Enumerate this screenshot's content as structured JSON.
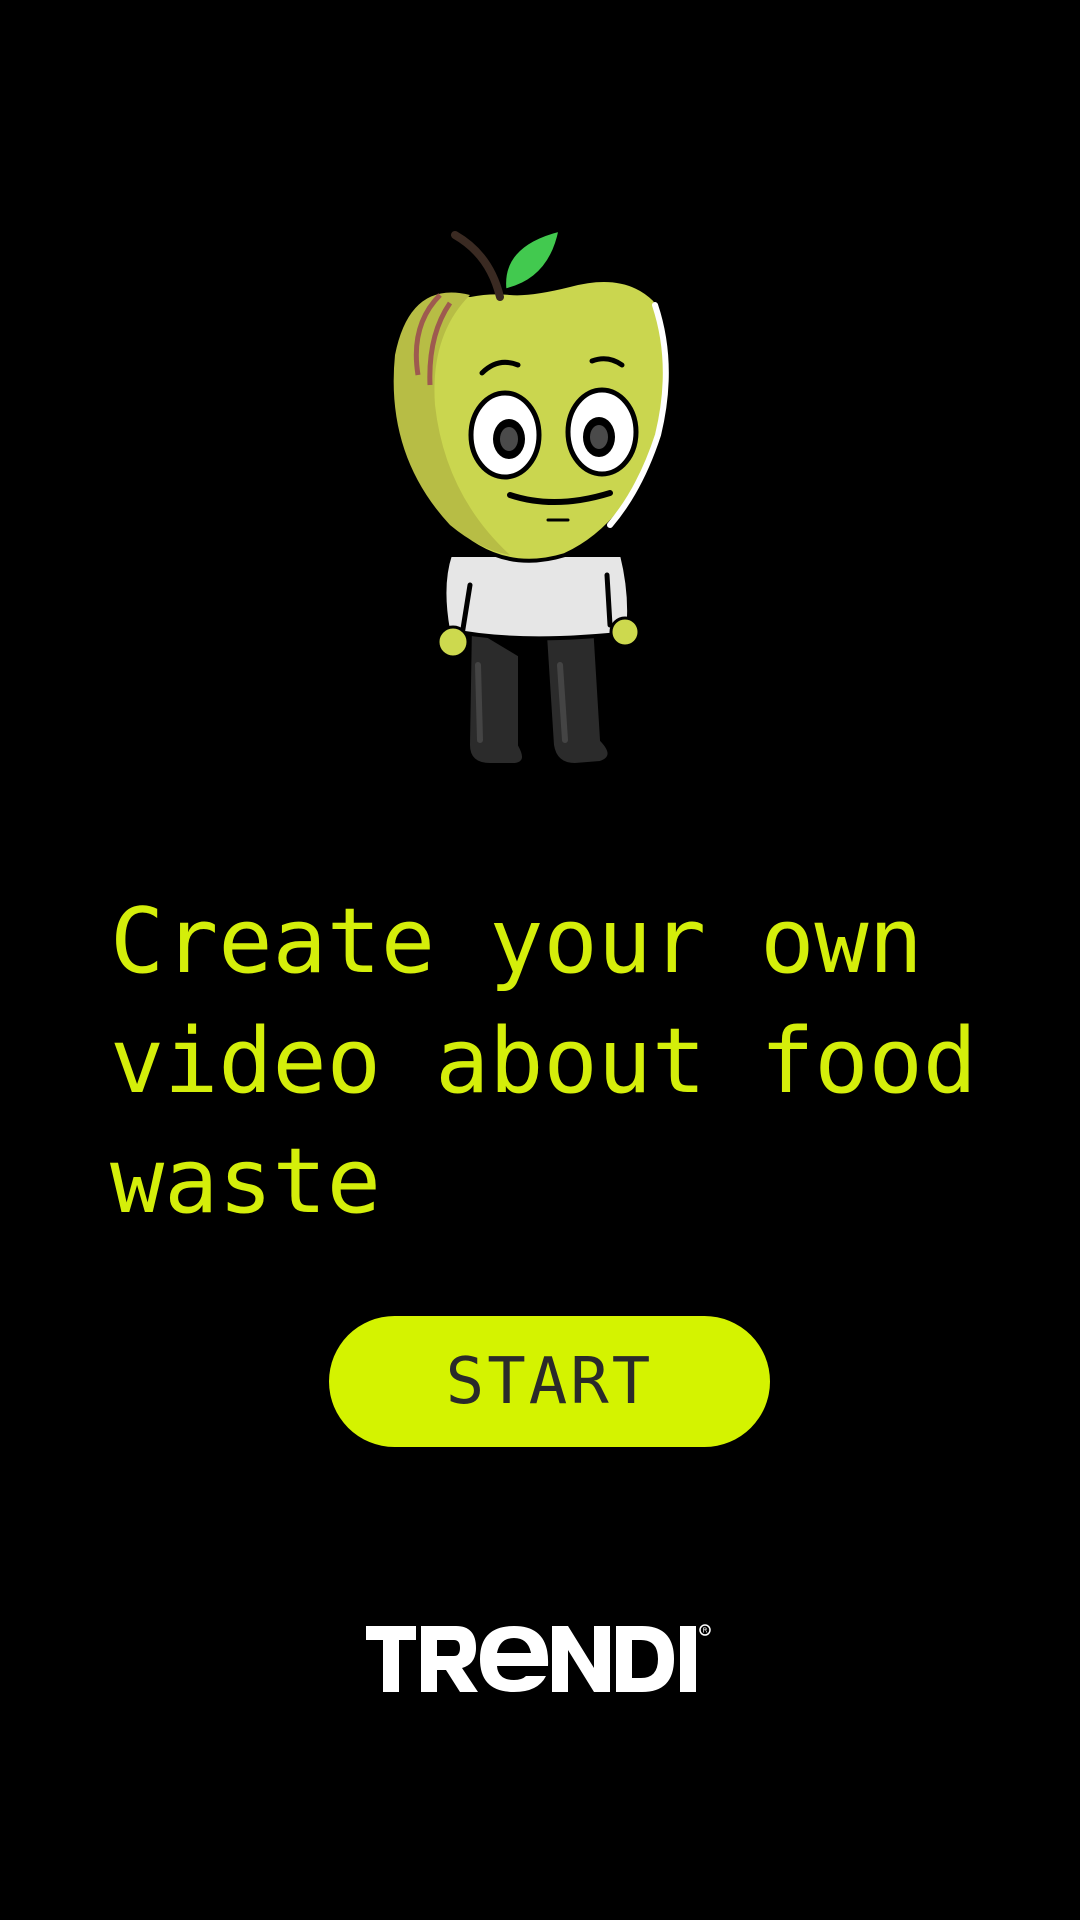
{
  "colors": {
    "background": "#000000",
    "accent": "#d4ee0a",
    "button_bg": "#d4f300",
    "button_text": "#2a2a2a",
    "logo": "#ffffff"
  },
  "mascot": {
    "icon": "apple-character-icon"
  },
  "headline": {
    "text": "Create your own\nvideo about food\nwaste"
  },
  "start_button": {
    "label": "START"
  },
  "logo": {
    "text": "TRENDI",
    "registered_mark": "®"
  }
}
